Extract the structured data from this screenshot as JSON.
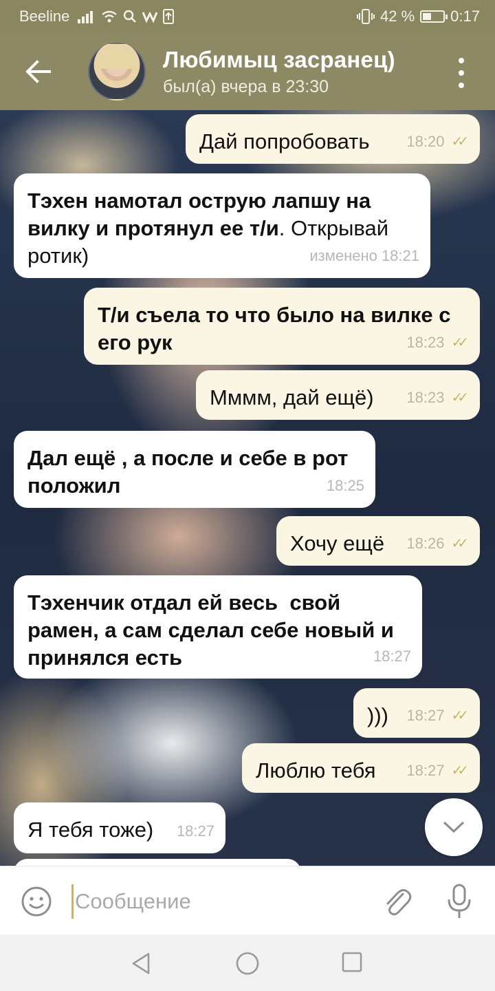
{
  "status_bar": {
    "carrier": "Beeline",
    "battery": "42 %",
    "battery_level": 0.42,
    "time": "0:17"
  },
  "header": {
    "title": "Любимыц засранец)",
    "status": "был(а) вчера в 23:30"
  },
  "messages": [
    {
      "dir": "out",
      "text": "Дай попробовать",
      "time": "18:20",
      "read": true
    },
    {
      "dir": "in",
      "text_bold": "Тэхен намотал острую лапшу на вилку и протянул ее т/и",
      "text": ". Открывай ротик)",
      "time": "изменено 18:21"
    },
    {
      "dir": "out",
      "text_bold": "Т/и съела то что было на вилке с его рук",
      "time": "18:23",
      "read": true
    },
    {
      "dir": "out",
      "text": "Мммм, дай ещё)",
      "time": "18:23",
      "read": true
    },
    {
      "dir": "in",
      "text_bold": "Дал ещё , а после и себе в рот положил",
      "time": "18:25"
    },
    {
      "dir": "out",
      "text": "Хочу ещё",
      "time": "18:26",
      "read": true
    },
    {
      "dir": "in",
      "text_bold": "Тэхенчик отдал ей весь  свой рамен, а сам сделал себе новый и принялся есть",
      "time": "18:27"
    },
    {
      "dir": "out",
      "text": ")))",
      "time": "18:27",
      "read": true
    },
    {
      "dir": "out",
      "text": "Люблю тебя",
      "time": "18:27",
      "read": true
    },
    {
      "dir": "in",
      "text": "Я тебя тоже)",
      "time": "18:27"
    }
  ],
  "input": {
    "placeholder": "Сообщение"
  },
  "icons": {
    "back": "arrow-left-icon",
    "menu": "kebab-menu-icon",
    "emoji": "smiley-icon",
    "attach": "paperclip-icon",
    "mic": "microphone-icon",
    "scroll": "chevron-down-icon"
  },
  "colors": {
    "header": "#8d8965",
    "status_bar": "#8a8660",
    "outgoing_bubble": "#fbf6e4",
    "incoming_bubble": "#ffffff",
    "read_ticks": "#c9b465"
  }
}
